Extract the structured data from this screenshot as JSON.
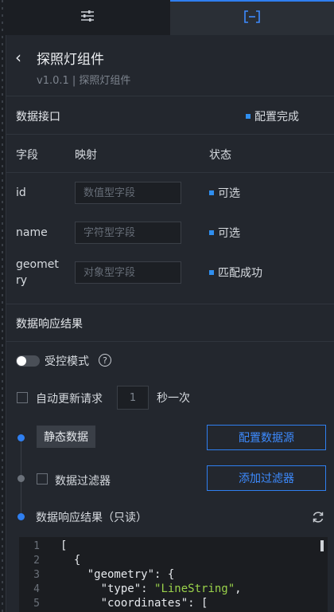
{
  "tabs": [
    {
      "icon": "sliders-icon"
    },
    {
      "icon": "bracket-icon",
      "active": true
    }
  ],
  "colors": {
    "accent": "#2f7ff0",
    "status_dot": "#2f8ff0",
    "json_string": "#9ad24a"
  },
  "header": {
    "title": "探照灯组件",
    "subtitle": "v1.0.1 | 探照灯组件"
  },
  "data_interface": {
    "title": "数据接口",
    "status": "配置完成",
    "columns": {
      "field": "字段",
      "mapping": "映射",
      "status": "状态"
    },
    "rows": [
      {
        "field": "id",
        "placeholder": "数值型字段",
        "status": "可选"
      },
      {
        "field": "name",
        "placeholder": "字符型字段",
        "status": "可选"
      },
      {
        "field_line1": "geomet",
        "field_line2": "ry",
        "placeholder": "对象型字段",
        "status": "匹配成功"
      }
    ]
  },
  "response": {
    "title": "数据响应结果",
    "controlled_mode": "受控模式",
    "help": "?",
    "auto_update": "自动更新请求",
    "interval_value": "1",
    "interval_suffix": "秒一次",
    "static_data": "静态数据",
    "configure_source": "配置数据源",
    "data_filter": "数据过滤器",
    "add_filter": "添加过滤器",
    "readonly_result": "数据响应结果（只读）"
  },
  "code_lines": [
    {
      "n": "1",
      "text": "["
    },
    {
      "n": "2",
      "text": "  {"
    },
    {
      "n": "3",
      "key": "    \"geometry\"",
      "rest": ": {"
    },
    {
      "n": "4",
      "key": "      \"type\"",
      "rest": ": ",
      "str": "\"LineString\"",
      "tail": ","
    },
    {
      "n": "5",
      "key": "      \"coordinates\"",
      "rest": ": ["
    }
  ]
}
